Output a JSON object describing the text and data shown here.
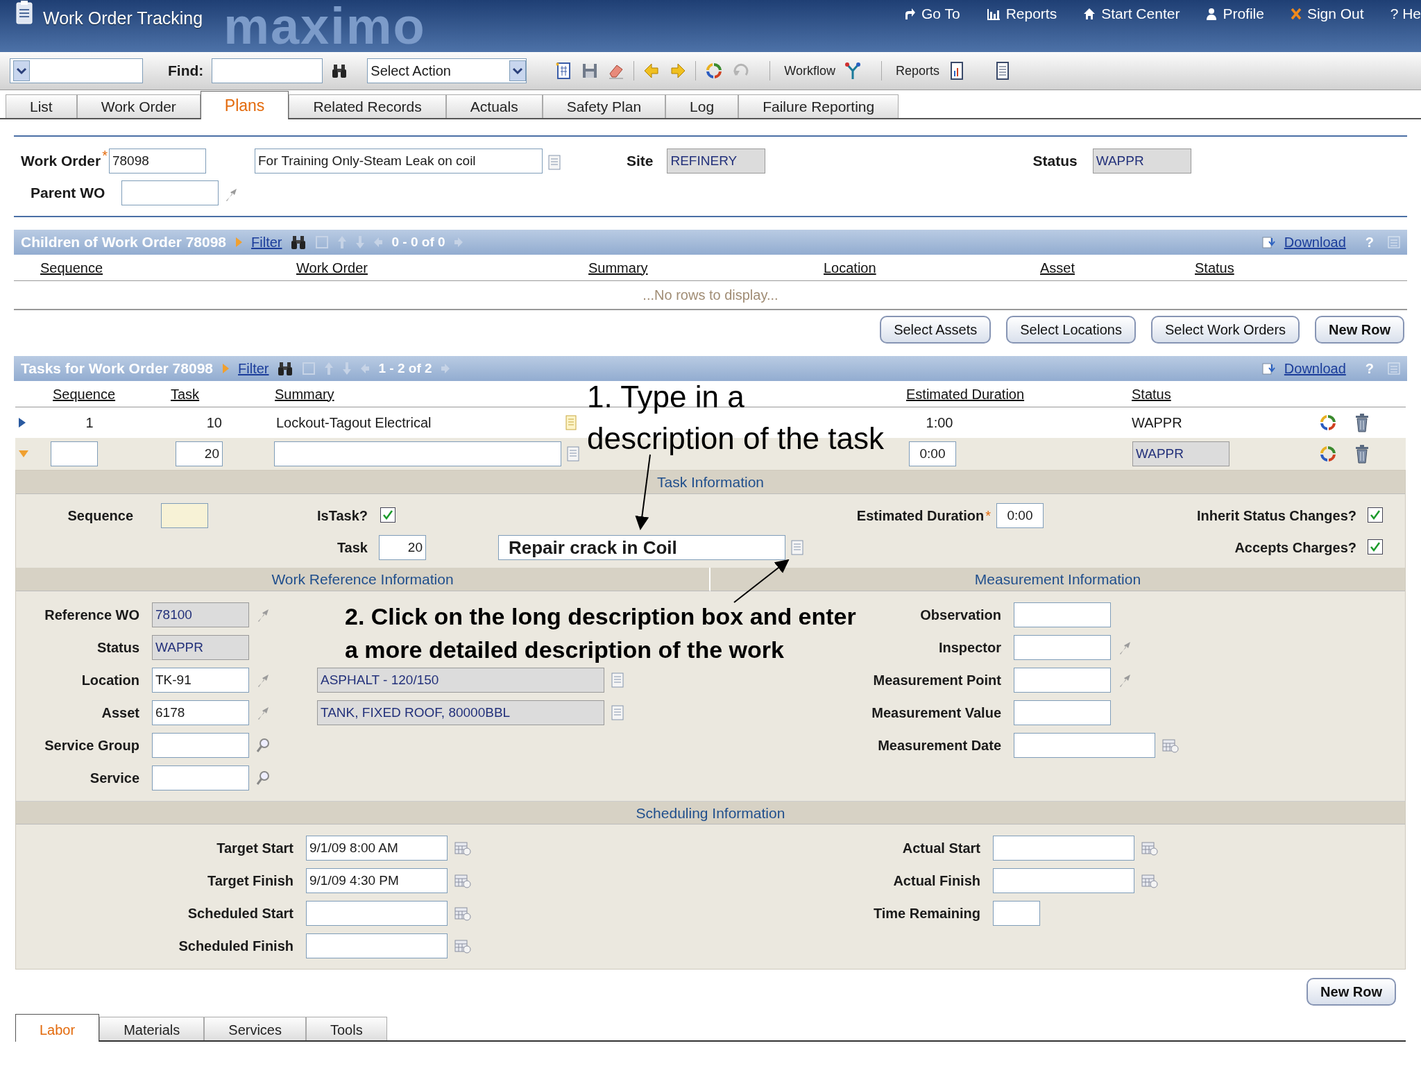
{
  "header": {
    "title": "Work Order Tracking",
    "logo": "maximo",
    "links": [
      "Go To",
      "Reports",
      "Start Center",
      "Profile",
      "Sign Out",
      "? He"
    ]
  },
  "toolbar": {
    "find_label": "Find:",
    "action": "Select Action",
    "workflow": "Workflow",
    "reports": "Reports"
  },
  "tabs": [
    {
      "label": "List",
      "selected": false
    },
    {
      "label": "Work Order",
      "selected": false
    },
    {
      "label": "Plans",
      "selected": true
    },
    {
      "label": "Related Records",
      "selected": false
    },
    {
      "label": "Actuals",
      "selected": false
    },
    {
      "label": "Safety Plan",
      "selected": false
    },
    {
      "label": "Log",
      "selected": false
    },
    {
      "label": "Failure Reporting",
      "selected": false
    }
  ],
  "work_order": {
    "label": "Work Order",
    "required_mark": "*",
    "number": "78098",
    "description": "For Training Only-Steam Leak on coil",
    "site_label": "Site",
    "site": "REFINERY",
    "status_label": "Status",
    "status": "WAPPR",
    "parent_label": "Parent WO"
  },
  "children": {
    "title": "Children of Work Order 78098",
    "filter": "Filter",
    "paging": "0 - 0 of 0",
    "download": "Download",
    "help": "?",
    "columns": [
      "Sequence",
      "Work Order",
      "Summary",
      "Location",
      "Asset",
      "Status"
    ],
    "empty_message": "...No rows to display...",
    "buttons": [
      "Select Assets",
      "Select Locations",
      "Select Work Orders",
      "New Row"
    ]
  },
  "tasks": {
    "title": "Tasks for Work Order 78098",
    "filter": "Filter",
    "paging": "1 - 2 of 2",
    "download": "Download",
    "help": "?",
    "columns": [
      "Sequence",
      "Task",
      "Summary",
      "Estimated Duration",
      "Status"
    ],
    "rows": [
      {
        "kind": "display",
        "expanded": false,
        "sequence": "1",
        "task": "10",
        "summary": "Lockout-Tagout Electrical",
        "duration": "1:00",
        "status": "WAPPR"
      },
      {
        "kind": "edit",
        "expanded": true,
        "task": "20",
        "duration": "0:00",
        "status": "WAPPR"
      }
    ]
  },
  "task_info": {
    "title": "Task Information",
    "sequence_label": "Sequence",
    "istask_label": "IsTask?",
    "istask_checked": true,
    "task_label": "Task",
    "task": "20",
    "summary": "Repair crack in Coil",
    "duration_label": "Estimated Duration",
    "required_mark": "*",
    "duration": "0:00",
    "inherit_label": "Inherit Status Changes?",
    "inherit_checked": true,
    "accepts_label": "Accepts Charges?",
    "accepts_checked": true
  },
  "work_reference": {
    "title": "Work Reference Information",
    "fields": [
      {
        "label": "Reference WO",
        "kind": "ref",
        "value": "78100"
      },
      {
        "label": "Status",
        "kind": "status",
        "value": "WAPPR"
      },
      {
        "label": "Location",
        "kind": "detail",
        "value": "TK-91",
        "description": "ASPHALT - 120/150"
      },
      {
        "label": "Asset",
        "kind": "detail",
        "value": "6178",
        "description": "TANK, FIXED ROOF, 80000BBL"
      },
      {
        "label": "Service Group",
        "kind": "search"
      },
      {
        "label": "Service",
        "kind": "search"
      }
    ]
  },
  "measurement": {
    "title": "Measurement Information",
    "fields": [
      {
        "label": "Observation",
        "kind": "text"
      },
      {
        "label": "Inspector",
        "kind": "detail"
      },
      {
        "label": "Measurement Point",
        "kind": "detail"
      },
      {
        "label": "Measurement Value",
        "kind": "text"
      },
      {
        "label": "Measurement Date",
        "kind": "date"
      }
    ]
  },
  "scheduling": {
    "title": "Scheduling Information",
    "left": [
      {
        "label": "Target Start",
        "kind": "date",
        "value": "9/1/09 8:00 AM"
      },
      {
        "label": "Target Finish",
        "kind": "date",
        "value": "9/1/09 4:30 PM"
      },
      {
        "label": "Scheduled Start",
        "kind": "date"
      },
      {
        "label": "Scheduled Finish",
        "kind": "date"
      }
    ],
    "right": [
      {
        "label": "Actual Start",
        "kind": "date"
      },
      {
        "label": "Actual Finish",
        "kind": "date"
      },
      {
        "label": "Time Remaining",
        "kind": "short"
      }
    ]
  },
  "bottom": {
    "button": "New Row",
    "tabs": [
      {
        "label": "Labor",
        "selected": true
      },
      {
        "label": "Materials",
        "selected": false
      },
      {
        "label": "Services",
        "selected": false
      },
      {
        "label": "Tools",
        "selected": false
      }
    ]
  },
  "annotations": [
    {
      "lines": [
        "1.  Type in a",
        "description of the task"
      ]
    },
    {
      "lines": [
        "2.  Click on the long description box and enter",
        "a more detailed description of the work"
      ]
    }
  ]
}
